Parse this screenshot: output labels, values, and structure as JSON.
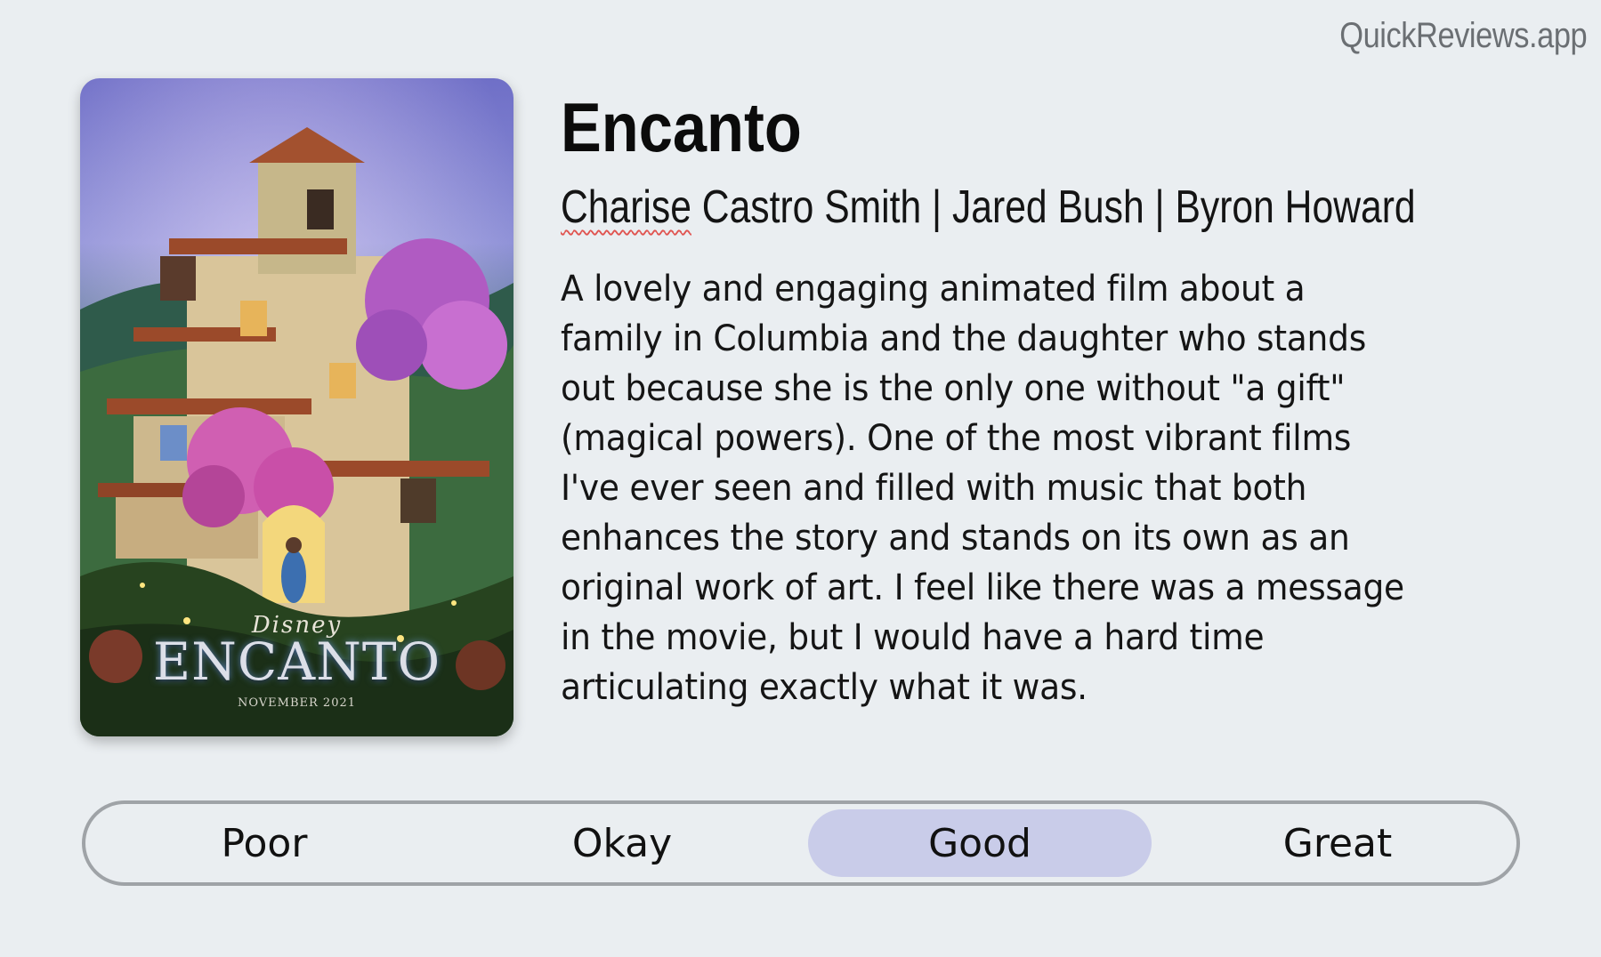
{
  "brand": "QuickReviews.app",
  "movie": {
    "title": "Encanto",
    "credits": {
      "first_name": "Charise",
      "rest": " Castro Smith | Jared Bush | Byron Howard"
    },
    "review": "A lovely and engaging animated film about a family in Columbia and the daughter who stands out because she is the only one without \"a gift\" (magical powers). One of the most vibrant films I've ever seen and filled with music that both enhances the story and stands on its own as an original work of art. I feel like there was a message in the movie, but I would have a hard time articulating exactly what it was.",
    "poster": {
      "studio": "Disney",
      "title": "ENCANTO",
      "release": "NOVEMBER 2021"
    }
  },
  "rating": {
    "options": [
      "Poor",
      "Okay",
      "Good",
      "Great"
    ],
    "selected": "Good",
    "selected_color": "#c9cce9"
  }
}
